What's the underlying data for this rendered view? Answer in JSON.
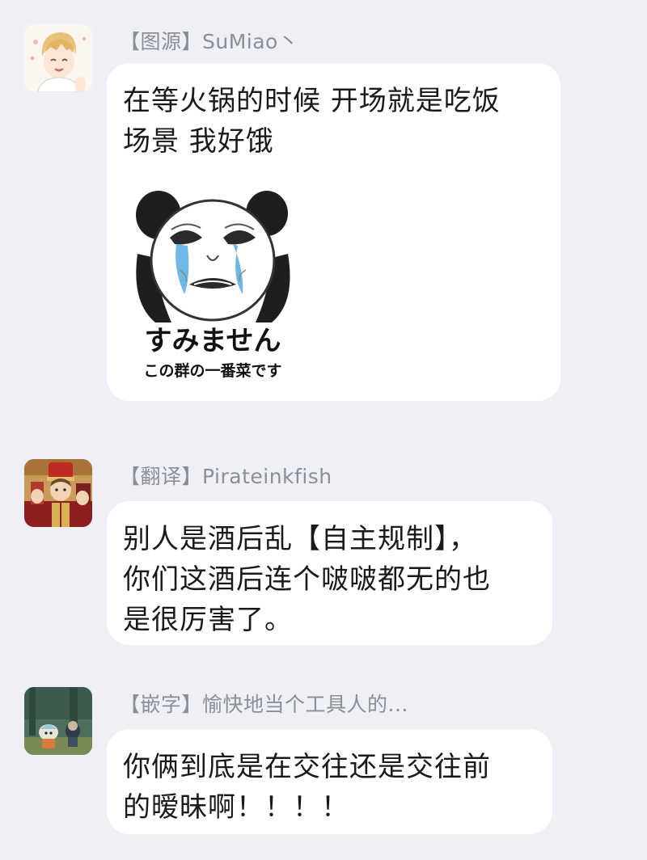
{
  "messages": [
    {
      "sender": "【图源】SuMiao丶",
      "text": "在等火锅的时候 开场就是吃饭\n场景 我好饿",
      "sticker": {
        "caption_main": "すみません",
        "caption_sub": "この群の一番菜です"
      }
    },
    {
      "sender": "【翻译】Pirateinkfish",
      "text": "别人是酒后乱【自主规制】，\n你们这酒后连个啵啵都无的也\n是很厉害了。"
    },
    {
      "sender": "【嵌字】愉快地当个工具人的...",
      "text": "你俩到底是在交往还是交往前\n的暧昧啊！！！！"
    }
  ]
}
